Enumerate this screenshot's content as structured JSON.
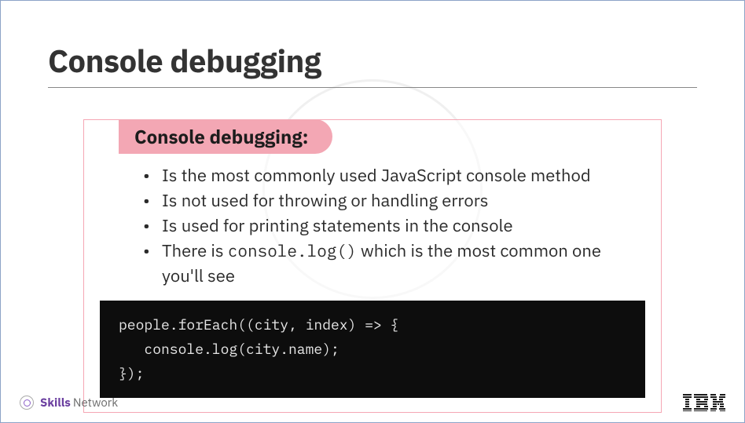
{
  "title": "Console debugging",
  "subtitle": "Console debugging:",
  "bullets": [
    "Is the most commonly used JavaScript console method",
    "Is not used for throwing or handling errors",
    "Is used for printing statements in the console"
  ],
  "bullet4_pre": "There is ",
  "bullet4_code": "console.log()",
  "bullet4_post": " which is the most common one you'll see",
  "code": "people.forEach((city, index) => {\n   console.log(city.name);\n});",
  "footer": {
    "skills": "Skills",
    "network": "Network",
    "ibm": "IBM"
  }
}
